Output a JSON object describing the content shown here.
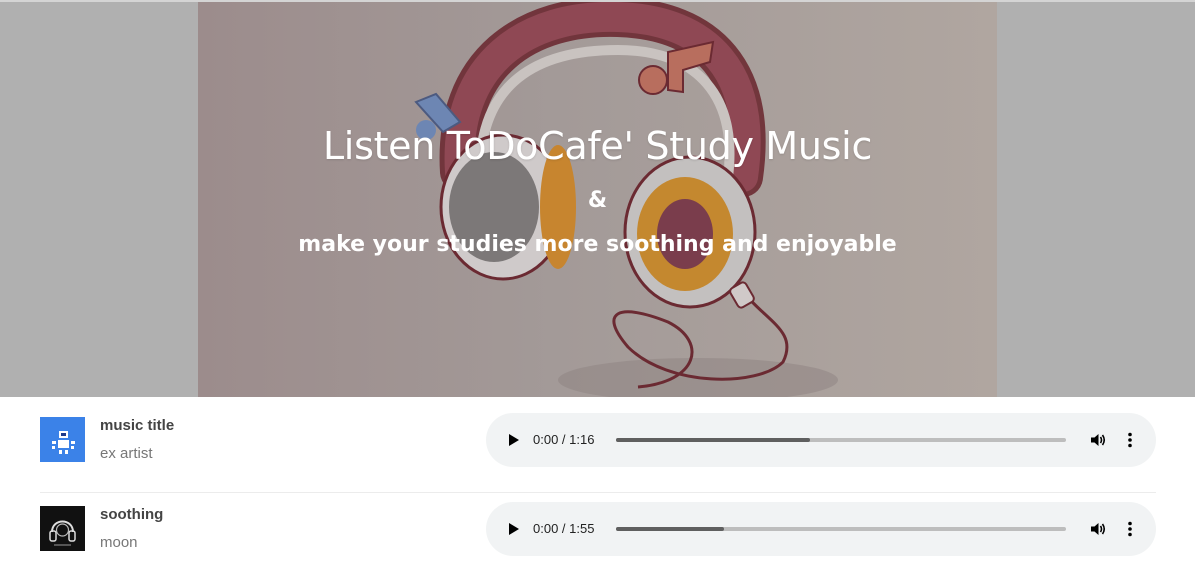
{
  "hero": {
    "title": "Listen ToDoCafe' Study Music",
    "ampersand": "&",
    "subtitle": "make your studies more soothing and enjoyable"
  },
  "tracks": [
    {
      "title": "music title",
      "artist": "ex artist",
      "time": "0:00 / 1:16",
      "buffered_fraction": 0.43,
      "cover_color": "#3b82e8"
    },
    {
      "title": "soothing",
      "artist": "moon",
      "time": "0:00 / 1:55",
      "buffered_fraction": 0.24,
      "cover_color": "#111111"
    }
  ],
  "icons": {
    "play": "play-icon",
    "volume": "volume-icon",
    "more": "more-vertical-icon"
  },
  "colors": {
    "hero_bg": "#b0b0b0",
    "player_bg": "#f1f3f4"
  }
}
